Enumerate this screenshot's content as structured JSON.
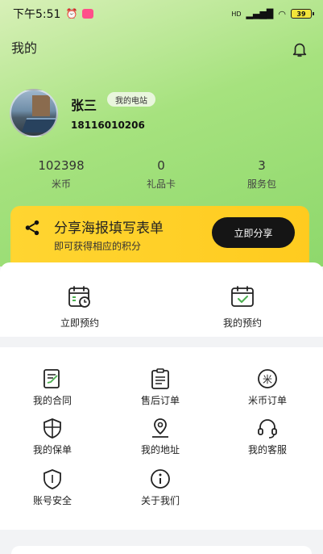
{
  "status_bar": {
    "time": "下午5:51",
    "network": "HD",
    "battery": "39"
  },
  "header": {
    "title": "我的"
  },
  "profile": {
    "name": "张三",
    "tag": "我的电站",
    "phone": "18116010206"
  },
  "stats": [
    {
      "value": "102398",
      "label": "米币"
    },
    {
      "value": "0",
      "label": "礼品卡"
    },
    {
      "value": "3",
      "label": "服务包"
    }
  ],
  "banner": {
    "title": "分享海报填写表单",
    "subtitle": "即可获得相应的积分",
    "button": "立即分享"
  },
  "quick_actions": [
    {
      "label": "立即预约",
      "icon": "calendar-clock-icon"
    },
    {
      "label": "我的预约",
      "icon": "calendar-check-icon"
    }
  ],
  "menu": [
    {
      "label": "我的合同",
      "icon": "contract-icon"
    },
    {
      "label": "售后订单",
      "icon": "clipboard-icon"
    },
    {
      "label": "米币订单",
      "icon": "coin-icon"
    },
    {
      "label": "我的保单",
      "icon": "shield-plus-icon"
    },
    {
      "label": "我的地址",
      "icon": "location-icon"
    },
    {
      "label": "我的客服",
      "icon": "headset-icon"
    },
    {
      "label": "账号安全",
      "icon": "shield-icon"
    },
    {
      "label": "关于我们",
      "icon": "info-icon"
    }
  ],
  "colors": {
    "accent_green": "#8ed86c",
    "banner_yellow": "#ffd531",
    "icon_green": "#4caf50"
  }
}
